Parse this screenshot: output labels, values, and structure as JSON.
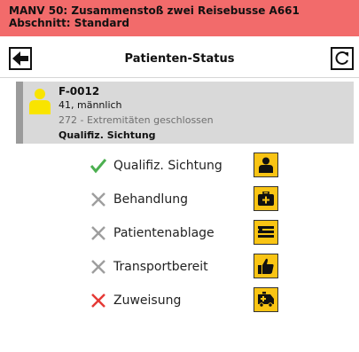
{
  "header": {
    "title": "MANV 50: Zusammenstoß zwei Reisebusse A661",
    "section": "Abschnitt: Standard",
    "color": "#f26b6b"
  },
  "navbar": {
    "title": "Patienten-Status",
    "back_icon": "arrow-left-icon",
    "refresh_icon": "refresh-icon"
  },
  "patient": {
    "id": "F-0012",
    "age_sex": "41, männlich",
    "code": "272 - Extremitäten geschlossen",
    "status": "Qualifiz. Sichtung",
    "avatar_color": "#f9e400"
  },
  "steps": [
    {
      "label": "Qualifiz. Sichtung",
      "state": "done",
      "icon": "person-icon"
    },
    {
      "label": "Behandlung",
      "state": "pending",
      "icon": "medkit-icon"
    },
    {
      "label": "Patientenablage",
      "state": "pending",
      "icon": "stretcher-icon"
    },
    {
      "label": "Transportbereit",
      "state": "pending",
      "icon": "thumbs-up-icon"
    },
    {
      "label": "Zuweisung",
      "state": "missing",
      "icon": "ambulance-icon"
    }
  ],
  "colors": {
    "done": "#4caf50",
    "pending": "#9e9e9e",
    "missing": "#e53935",
    "action": "#f9c414"
  }
}
